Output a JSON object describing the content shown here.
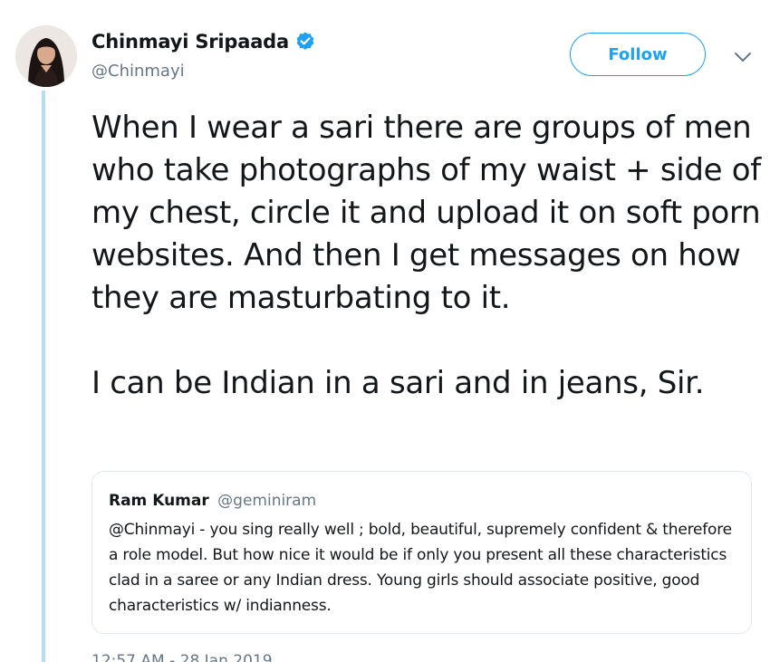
{
  "author": {
    "display_name": "Chinmayi Sripaada",
    "handle": "@Chinmayi",
    "verified": true,
    "avatar_icon": "profile-photo"
  },
  "actions": {
    "follow_label": "Follow",
    "more_icon": "chevron-down-icon"
  },
  "tweet": {
    "paragraphs": [
      "When I wear a sari there are groups of men who take photographs of my waist + side of my chest, circle it and upload it on soft porn websites. And then I get messages on how they are masturbating to it.",
      "I can be Indian in a sari and in jeans, Sir."
    ],
    "timestamp": "12:57 AM - 28 Jan 2019"
  },
  "quoted_tweet": {
    "name": "Ram Kumar",
    "handle": "@geminiram",
    "text": "@Chinmayi - you sing really well ; bold, beautiful, supremely confident & therefore a role model. But how nice it would be if only you present all these characteristics clad in a saree or any Indian dress. Young girls should associate positive, good characteristics w/ indianness."
  },
  "colors": {
    "accent": "#1da1f2",
    "thread_line": "#b4dcf5",
    "secondary_text": "#657786",
    "border": "#e1e8ed"
  }
}
